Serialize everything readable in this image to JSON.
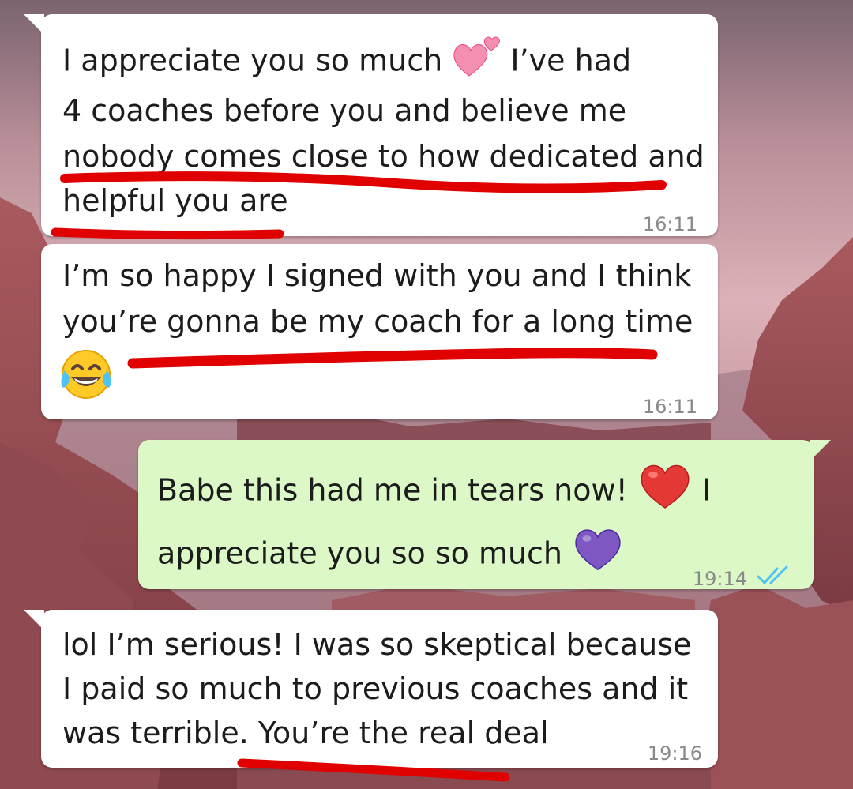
{
  "messages": [
    {
      "direction": "incoming",
      "lines": [
        "I appreciate you so much",
        "I’ve had",
        "4 coaches before you and believe me",
        "nobody comes close to how dedicated and",
        "helpful you are"
      ],
      "emoji": "two-hearts-icon",
      "time": "16:11"
    },
    {
      "direction": "incoming",
      "lines": [
        "I’m so happy I signed with you and I think",
        "you’re gonna be my coach for a long time"
      ],
      "emoji": "tears-of-joy-icon",
      "time": "16:11"
    },
    {
      "direction": "outgoing",
      "lines": [
        "Babe this had me in tears now!",
        "I",
        "appreciate you so so much"
      ],
      "emoji": [
        "red-heart-icon",
        "purple-heart-icon"
      ],
      "time": "19:14",
      "status": "read-double-check-icon"
    },
    {
      "direction": "incoming",
      "lines": [
        "lol I’m serious! I was so skeptical because",
        "I paid so much to previous coaches and it",
        "was terrible. You’re the real deal"
      ],
      "time": "19:16"
    }
  ],
  "colors": {
    "incoming_bubble": "#ffffff",
    "outgoing_bubble": "#dcf8c6",
    "underline": "#e00000",
    "read_ticks": "#4fc3f7"
  }
}
